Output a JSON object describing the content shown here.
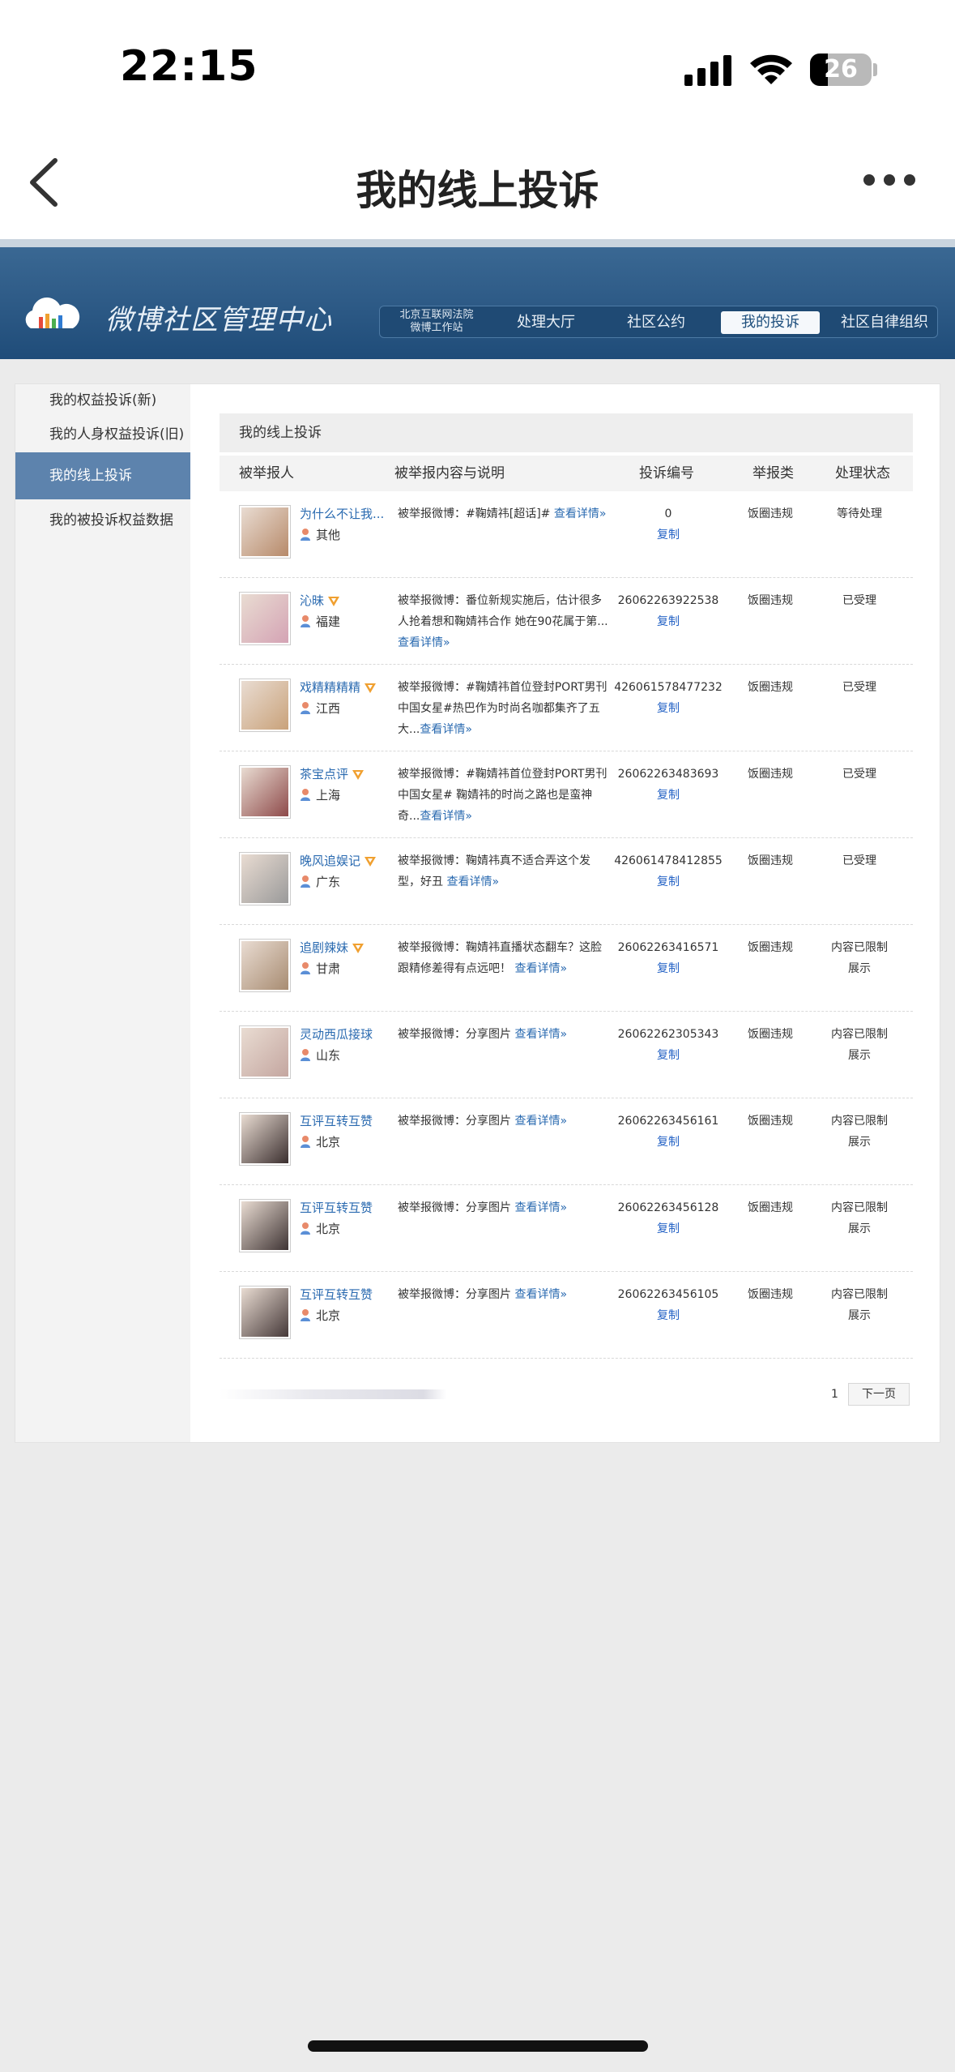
{
  "status_bar": {
    "time": "22:15",
    "battery": "26"
  },
  "nav": {
    "title": "我的线上投诉"
  },
  "header": {
    "title": "微博社区管理中心",
    "court_line1": "北京互联网法院",
    "court_line2": "微博工作站",
    "nav_items": [
      "处理大厅",
      "社区公约",
      "我的投诉",
      "社区自律组织"
    ],
    "active_nav": "我的投诉"
  },
  "sidebar": {
    "items": [
      "我的权益投诉(新)",
      "我的人身权益投诉(旧)",
      "我的线上投诉",
      "我的被投诉权益数据"
    ],
    "active": "我的线上投诉"
  },
  "panel": {
    "title": "我的线上投诉"
  },
  "table": {
    "columns": [
      "被举报人",
      "被举报内容与说明",
      "投诉编号",
      "举报类",
      "处理状态"
    ],
    "link_text": "查看详情»",
    "copy_text": "复制",
    "rows": [
      {
        "name": "为什么不让我...",
        "verified": false,
        "location": "其他",
        "desc": "被举报微博：#鞠婧祎[超话]# ",
        "link": "查看详情»",
        "id": "0",
        "type": "饭圈违规",
        "status_lines": [
          "等待处理"
        ]
      },
      {
        "name": "沁昧",
        "verified": true,
        "location": "福建",
        "desc": "被举报微博：番位新规实施后，估计很多人抢着想和鞠婧祎合作 她在90花属于第...",
        "link": "查看详情»",
        "id": "26062263922538",
        "type": "饭圈违规",
        "status_lines": [
          "已受理"
        ]
      },
      {
        "name": "戏精精精精",
        "verified": true,
        "location": "江西",
        "desc": "被举报微博：#鞠婧祎首位登封PORT男刊中国女星#热巴作为时尚名咖都集齐了五大...",
        "link": "查看详情»",
        "id": "426061578477232",
        "type": "饭圈违规",
        "status_lines": [
          "已受理"
        ]
      },
      {
        "name": "茶宝点评",
        "verified": true,
        "location": "上海",
        "desc": "被举报微博：#鞠婧祎首位登封PORT男刊中国女星# 鞠婧祎的时尚之路也是蛮神奇...",
        "link": "查看详情»",
        "id": "26062263483693",
        "type": "饭圈违规",
        "status_lines": [
          "已受理"
        ]
      },
      {
        "name": "晚风追娱记",
        "verified": true,
        "location": "广东",
        "desc": "被举报微博：鞠婧祎真不适合弄这个发型，好丑 ",
        "link": "查看详情»",
        "id": "426061478412855",
        "type": "饭圈违规",
        "status_lines": [
          "已受理"
        ]
      },
      {
        "name": "追剧辣妹",
        "verified": true,
        "location": "甘肃",
        "desc": "被举报微博：鞠婧祎直播状态翻车？这脸跟精修差得有点远吧！ ",
        "link": "查看详情»",
        "id": "26062263416571",
        "type": "饭圈违规",
        "status_lines": [
          "内容已限制",
          "展示"
        ]
      },
      {
        "name": "灵动西瓜接球",
        "verified": false,
        "location": "山东",
        "desc": "被举报微博：分享图片 ",
        "link": "查看详情»",
        "id": "26062262305343",
        "type": "饭圈违规",
        "status_lines": [
          "内容已限制",
          "展示"
        ]
      },
      {
        "name": "互评互转互赞",
        "verified": false,
        "location": "北京",
        "desc": "被举报微博：分享图片 ",
        "link": "查看详情»",
        "id": "26062263456161",
        "type": "饭圈违规",
        "status_lines": [
          "内容已限制",
          "展示"
        ]
      },
      {
        "name": "互评互转互赞",
        "verified": false,
        "location": "北京",
        "desc": "被举报微博：分享图片 ",
        "link": "查看详情»",
        "id": "26062263456128",
        "type": "饭圈违规",
        "status_lines": [
          "内容已限制",
          "展示"
        ]
      },
      {
        "name": "互评互转互赞",
        "verified": false,
        "location": "北京",
        "desc": "被举报微博：分享图片 ",
        "link": "查看详情»",
        "id": "26062263456105",
        "type": "饭圈违规",
        "status_lines": [
          "内容已限制",
          "展示"
        ]
      }
    ]
  },
  "pager": {
    "page": "1",
    "next": "下一页"
  },
  "colors": {
    "header_blue": "#2d5a86",
    "link_blue": "#2a6ab0",
    "sidebar_active": "#5d83ad",
    "verified_orange": "#f0a030"
  }
}
